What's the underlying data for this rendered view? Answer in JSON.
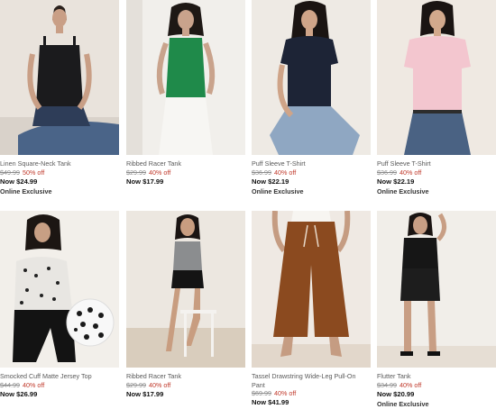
{
  "products": [
    {
      "name": "Linen Square-Neck Tank",
      "original_price": "$49.99",
      "discount": "50% off",
      "sale_price": "Now $24.99",
      "badge": "Online Exclusive",
      "photo_icon": "model-photo-black-linen-tank"
    },
    {
      "name": "Ribbed Racer Tank",
      "original_price": "$29.99",
      "discount": "40% off",
      "sale_price": "Now $17.99",
      "badge": "",
      "photo_icon": "model-photo-green-racer-tank"
    },
    {
      "name": "Puff Sleeve T-Shirt",
      "original_price": "$36.99",
      "discount": "40% off",
      "sale_price": "Now $22.19",
      "badge": "Online Exclusive",
      "photo_icon": "model-photo-navy-puff-tee"
    },
    {
      "name": "Puff Sleeve T-Shirt",
      "original_price": "$36.99",
      "discount": "40% off",
      "sale_price": "Now $22.19",
      "badge": "Online Exclusive",
      "photo_icon": "model-photo-pink-puff-tee"
    },
    {
      "name": "Smocked Cuff Matte Jersey Top",
      "original_price": "$44.99",
      "discount": "40% off",
      "sale_price": "Now $26.99",
      "badge": "",
      "photo_icon": "model-photo-print-jersey-top"
    },
    {
      "name": "Ribbed Racer Tank",
      "original_price": "$29.99",
      "discount": "40% off",
      "sale_price": "Now $17.99",
      "badge": "",
      "photo_icon": "model-photo-grey-racer-tank"
    },
    {
      "name": "Tassel Drawstring Wide-Leg Pull-On Pant",
      "original_price": "$69.99",
      "discount": "40% off",
      "sale_price": "Now $41.99",
      "badge": "",
      "photo_icon": "model-photo-brown-wide-leg-pant"
    },
    {
      "name": "Flutter Tank",
      "original_price": "$34.99",
      "discount": "40% off",
      "sale_price": "Now $20.99",
      "badge": "Online Exclusive",
      "photo_icon": "model-photo-black-flutter-tank"
    }
  ],
  "colors": {
    "discount_red": "#c0392b",
    "strike_grey": "#8c8c8c",
    "name_grey": "#5a5a5a"
  }
}
